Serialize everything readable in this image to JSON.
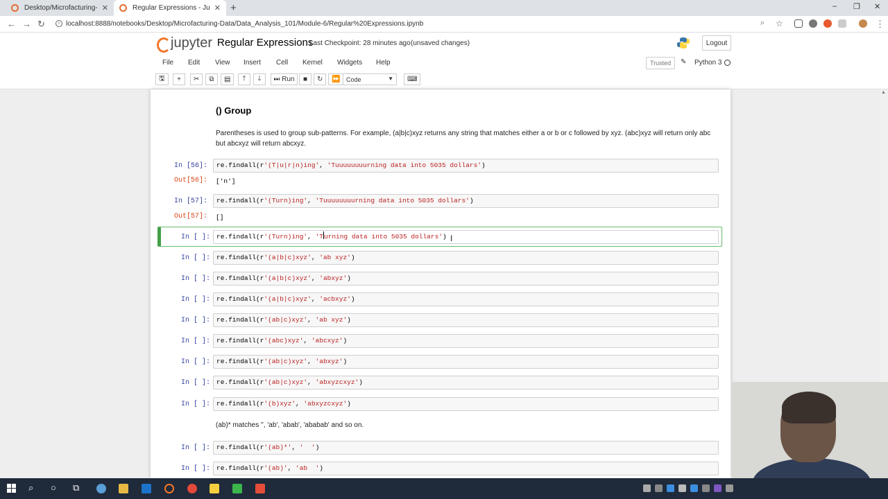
{
  "browser": {
    "tabs": [
      {
        "title": "Desktop/Microfacturing-Data/Da",
        "active": false
      },
      {
        "title": "Regular Expressions - Jupyter No",
        "active": true
      }
    ],
    "new_tab_label": "+",
    "url": "localhost:8888/notebooks/Desktop/Microfacturing-Data/Data_Analysis_101/Module-6/Regular%20Expressions.ipynb",
    "window_controls": [
      "–",
      "❐",
      "✕"
    ]
  },
  "jupyter": {
    "logo_text": "jupyter",
    "notebook_name": "Regular Expressions",
    "checkpoint": "Last Checkpoint: 28 minutes ago",
    "unsaved": "(unsaved changes)",
    "logout_label": "Logout",
    "menu": [
      "File",
      "Edit",
      "View",
      "Insert",
      "Cell",
      "Kernel",
      "Widgets",
      "Help"
    ],
    "trusted_label": "Trusted",
    "kernel_name": "Python 3",
    "toolbar": {
      "run_label": "Run",
      "cell_type": "Code"
    }
  },
  "notebook": {
    "heading": "() Group",
    "paragraph": "Parentheses is used to group sub-patterns. For example, (a|b|c)xyz returns any string that matches either a or b or c followed by xyz. (abc)xyz will return only abc but abcxyz will return abcxyz.",
    "cells": [
      {
        "prompt": "In [56]:",
        "code_pre": "re.findall(r",
        "code_str1": "'(T|u|r|n)ing'",
        "code_mid": ", ",
        "code_str2": "'Tuuuuuuuurning data into 5035 dollars'",
        "code_post": ")",
        "out_prompt": "Out[56]:",
        "output": "['n']"
      },
      {
        "prompt": "In [57]:",
        "code_pre": "re.findall(r",
        "code_str1": "'(Turn)ing'",
        "code_mid": ", ",
        "code_str2": "'Tuuuuuuuurning data into 5035 dollars'",
        "code_post": ")",
        "out_prompt": "Out[57]:",
        "output": "[]"
      },
      {
        "prompt": "In [ ]:",
        "code_pre": "re.findall(r",
        "code_str1": "'(Turn)ing'",
        "code_mid": ", ",
        "code_str2a": "'T",
        "code_str2b": "urning data into 5035 dollars'",
        "code_post": ")"
      },
      {
        "prompt": "In [ ]:",
        "code_pre": "re.findall(r",
        "code_str1": "'(a|b|c)xyz'",
        "code_mid": ", ",
        "code_str2": "'ab xyz'",
        "code_post": ")"
      },
      {
        "prompt": "In [ ]:",
        "code_pre": "re.findall(r",
        "code_str1": "'(a|b|c)xyz'",
        "code_mid": ", ",
        "code_str2": "'abxyz'",
        "code_post": ")"
      },
      {
        "prompt": "In [ ]:",
        "code_pre": "re.findall(r",
        "code_str1": "'(a|b|c)xyz'",
        "code_mid": ", ",
        "code_str2": "'acbxyz'",
        "code_post": ")"
      },
      {
        "prompt": "In [ ]:",
        "code_pre": "re.findall(r",
        "code_str1": "'(ab|c)xyz'",
        "code_mid": ", ",
        "code_str2": "'ab xyz'",
        "code_post": ")"
      },
      {
        "prompt": "In [ ]:",
        "code_pre": "re.findall(r",
        "code_str1": "'(abc)xyz'",
        "code_mid": ", ",
        "code_str2": "'abcxyz'",
        "code_post": ")"
      },
      {
        "prompt": "In [ ]:",
        "code_pre": "re.findall(r",
        "code_str1": "'(ab|c)xyz'",
        "code_mid": ", ",
        "code_str2": "'abxyz'",
        "code_post": ")"
      },
      {
        "prompt": "In [ ]:",
        "code_pre": "re.findall(r",
        "code_str1": "'(ab|c)xyz'",
        "code_mid": ", ",
        "code_str2": "'abxyzcxyz'",
        "code_post": ")"
      },
      {
        "prompt": "In [ ]:",
        "code_pre": "re.findall(r",
        "code_str1": "'(b)xyz'",
        "code_mid": ", ",
        "code_str2": "'abxyzcxyz'",
        "code_post": ")"
      },
      {
        "prompt": "In [ ]:",
        "code_pre": "re.findall(r",
        "code_str1": "'(ab)*'",
        "code_mid": ", ",
        "code_str2": "'  '",
        "code_post": ")"
      },
      {
        "prompt": "In [ ]:",
        "code_pre": "re.findall(r",
        "code_str1": "'(ab)'",
        "code_mid": ", ",
        "code_str2": "'ab  '",
        "code_post": ")"
      }
    ],
    "note": "(ab)* matches '', 'ab', 'abab', 'ababab' and so on."
  },
  "colors": {
    "accent_green": "#42a047",
    "prompt_in": "#303f9f",
    "prompt_out": "#d84315",
    "string": "#ba2121",
    "jupyter_orange": "#f37726"
  }
}
